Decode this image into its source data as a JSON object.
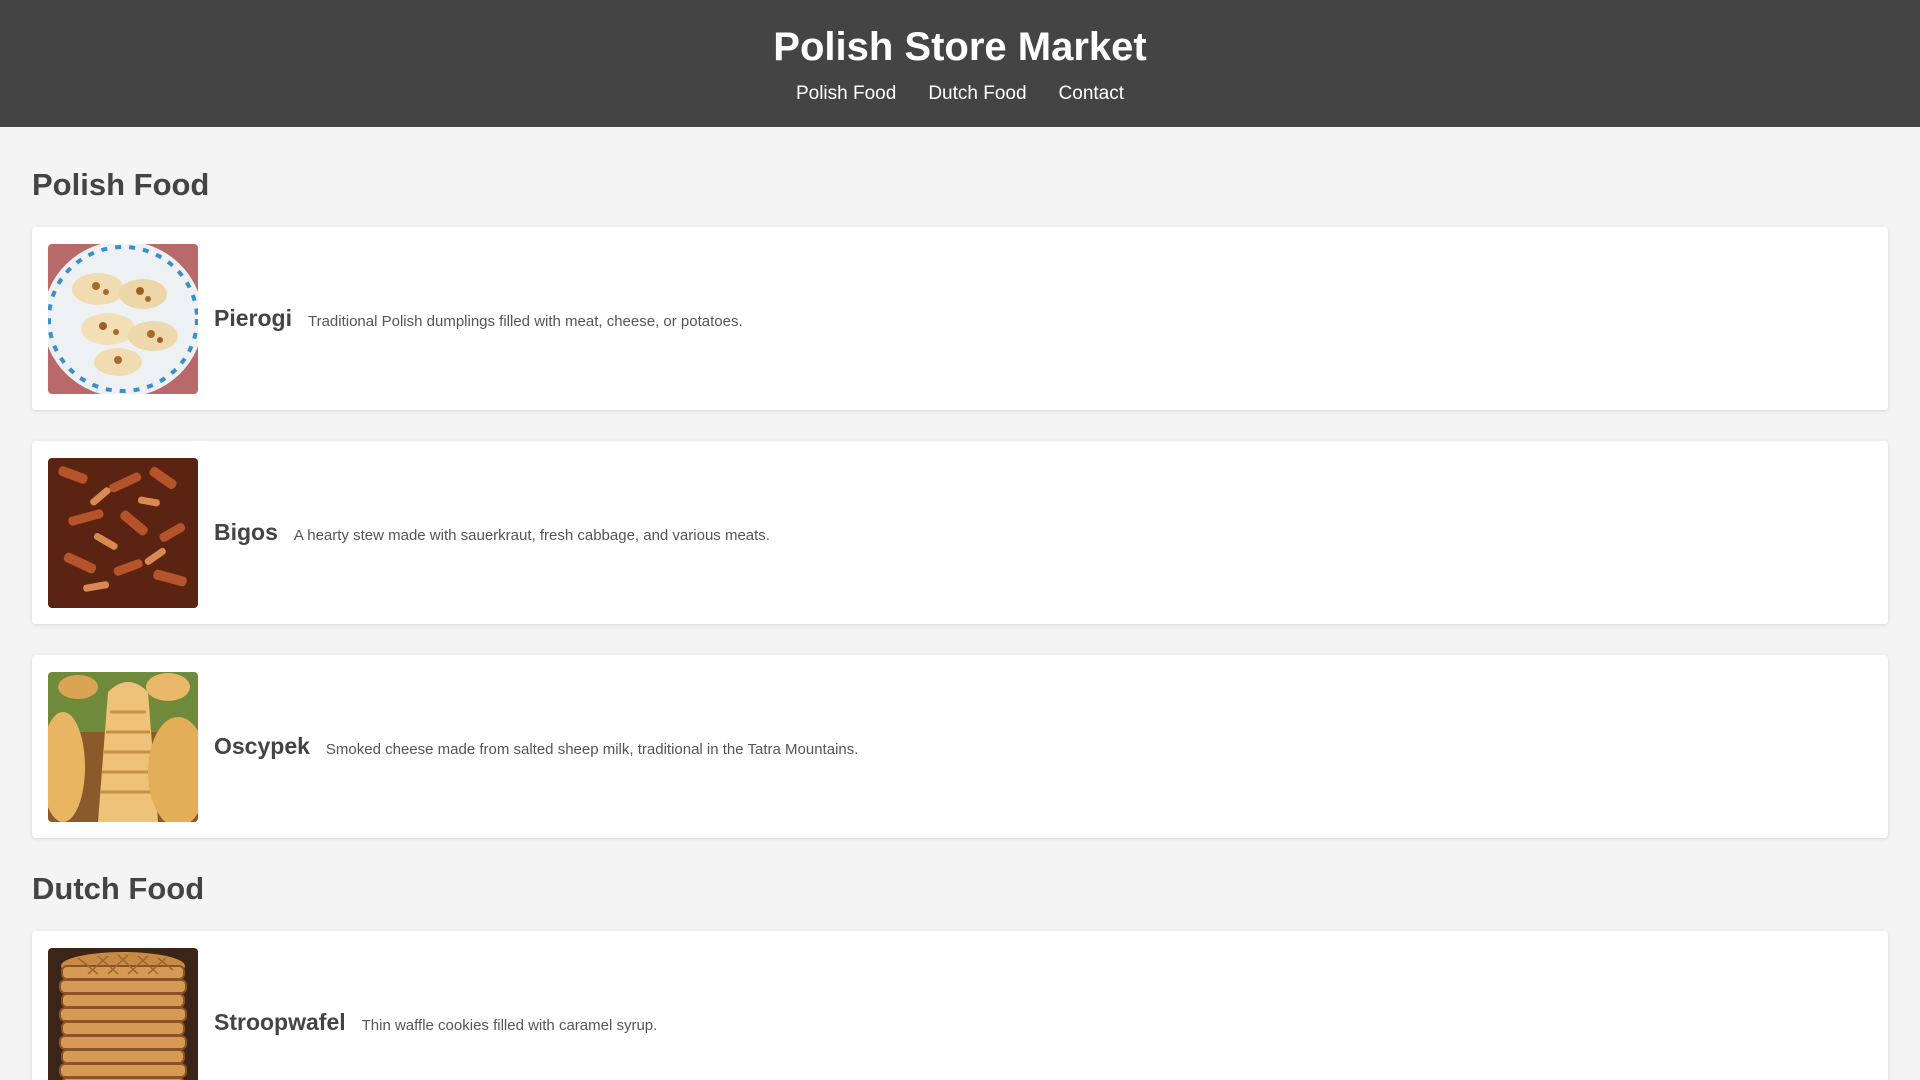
{
  "header": {
    "title": "Polish Store Market",
    "nav": [
      {
        "label": "Polish Food"
      },
      {
        "label": "Dutch Food"
      },
      {
        "label": "Contact"
      }
    ]
  },
  "sections": [
    {
      "title": "Polish Food",
      "items": [
        {
          "name": "Pierogi",
          "description": "Traditional Polish dumplings filled with meat, cheese, or potatoes.",
          "image": "pierogi-plate-photo"
        },
        {
          "name": "Bigos",
          "description": "A hearty stew made with sauerkraut, fresh cabbage, and various meats.",
          "image": "bigos-stew-photo"
        },
        {
          "name": "Oscypek",
          "description": "Smoked cheese made from salted sheep milk, traditional in the Tatra Mountains.",
          "image": "oscypek-cheese-photo"
        }
      ]
    },
    {
      "title": "Dutch Food",
      "items": [
        {
          "name": "Stroopwafel",
          "description": "Thin waffle cookies filled with caramel syrup.",
          "image": "stroopwafel-stack-photo"
        }
      ]
    }
  ],
  "colors": {
    "header_bg": "#444444",
    "page_bg": "#f4f4f4",
    "card_bg": "#ffffff"
  }
}
